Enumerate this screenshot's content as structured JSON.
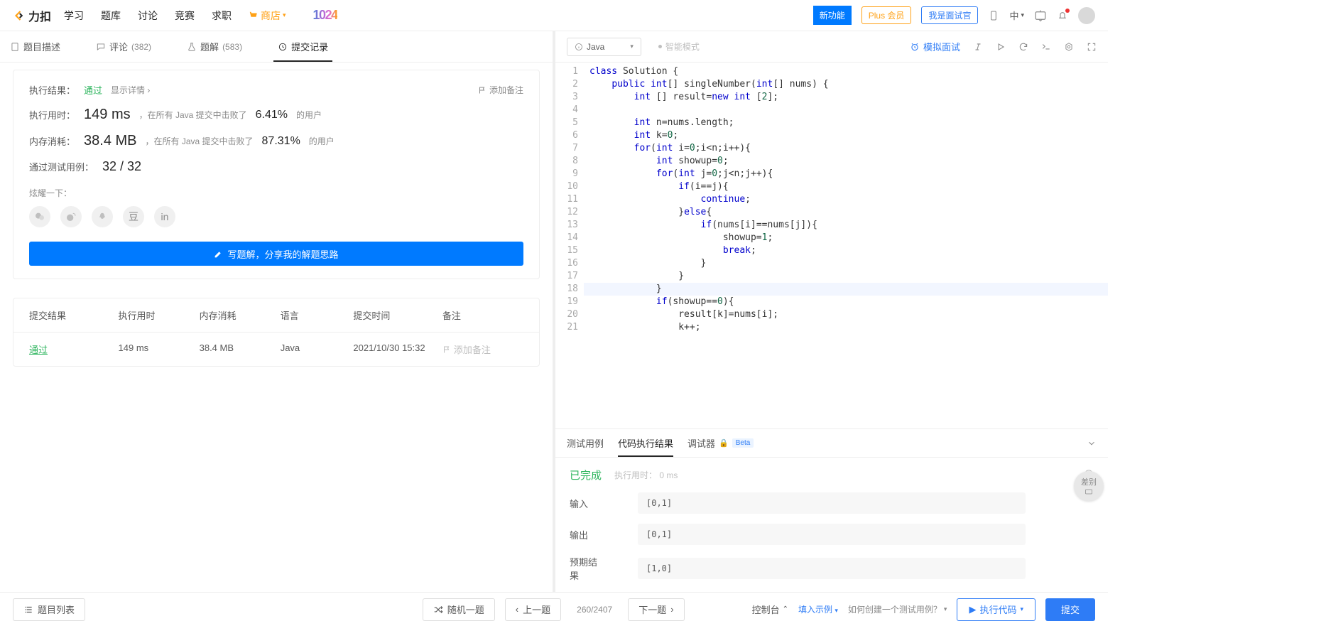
{
  "topnav": {
    "brand": "力扣",
    "links": [
      "学习",
      "题库",
      "讨论",
      "竞赛",
      "求职"
    ],
    "store": "商店",
    "promo": "1024",
    "new_feature": "新功能",
    "plus": "Plus 会员",
    "interviewer": "我是面试官",
    "lang": "中"
  },
  "left_tabs": {
    "desc": "题目描述",
    "comments": "评论",
    "comments_count": "(382)",
    "solutions": "题解",
    "solutions_count": "(583)",
    "submissions": "提交记录"
  },
  "result": {
    "label": "执行结果：",
    "status": "通过",
    "show_detail": "显示详情",
    "add_note": "添加备注",
    "time_label": "执行用时：",
    "time_value": "149 ms",
    "time_ctx1": "，在所有 Java 提交中击败了",
    "time_pct": "6.41%",
    "time_ctx2": "的用户",
    "mem_label": "内存消耗：",
    "mem_value": "38.4 MB",
    "mem_ctx1": "，在所有 Java 提交中击败了",
    "mem_pct": "87.31%",
    "mem_ctx2": "的用户",
    "cases_label": "通过测试用例：",
    "cases_value": "32 / 32",
    "share_label": "炫耀一下：",
    "write_solution": "写题解，分享我的解题思路"
  },
  "sub_table": {
    "headers": {
      "result": "提交结果",
      "time": "执行用时",
      "mem": "内存消耗",
      "lang": "语言",
      "date": "提交时间",
      "note": "备注"
    },
    "rows": [
      {
        "result": "通过",
        "time": "149 ms",
        "mem": "38.4 MB",
        "lang": "Java",
        "date": "2021/10/30 15:32",
        "note": "添加备注"
      }
    ]
  },
  "editor": {
    "language": "Java",
    "smart_mode": "智能模式",
    "mock": "模拟面试",
    "lines": 21,
    "highlight_line": 18
  },
  "exec_tabs": {
    "cases": "测试用例",
    "result": "代码执行结果",
    "debugger": "调试器",
    "beta": "Beta"
  },
  "exec": {
    "status": "已完成",
    "elapsed_label": "执行用时：",
    "elapsed_value": "0 ms",
    "input_label": "输入",
    "input_value": "[0,1]",
    "output_label": "输出",
    "output_value": "[0,1]",
    "expected_label": "预期结果",
    "expected_value": "[1,0]",
    "diff": "差别"
  },
  "footer": {
    "list": "题目列表",
    "random": "随机一题",
    "prev": "上一题",
    "next": "下一题",
    "counter": "260/2407",
    "console": "控制台",
    "example": "填入示例",
    "help": "如何创建一个测试用例？",
    "run": "执行代码",
    "submit": "提交"
  }
}
